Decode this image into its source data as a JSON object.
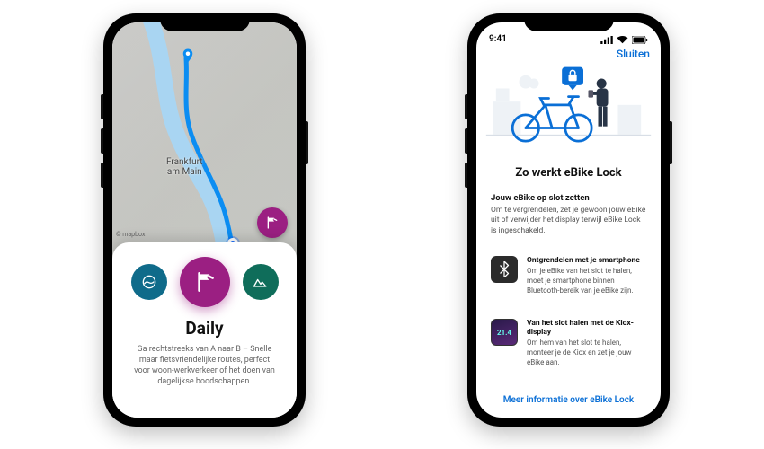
{
  "leftPhone": {
    "map": {
      "cityLabel": "Frankfurt\nam Main",
      "attribution": "© mapbox"
    },
    "fabIcon": "flag",
    "sheet": {
      "modes": {
        "leisure": "leisure",
        "daily": "daily",
        "mountain": "mountain"
      },
      "title": "Daily",
      "desc": "Ga rechtstreeks van A naar B – Snelle maar fietsvriendelijke routes, perfect voor woon-werkverkeer of het doen van dagelijkse boodschappen."
    }
  },
  "rightPhone": {
    "status": {
      "time": "9:41"
    },
    "close": "Sluiten",
    "title": "Zo werkt eBike Lock",
    "intro": {
      "heading": "Jouw eBike op slot zetten",
      "text": "Om te vergrendelen, zet je gewoon jouw eBike uit of verwijder het display terwijl eBike Lock is ingeschakeld."
    },
    "feat1": {
      "heading": "Ontgrendelen met je smartphone",
      "text": "Om je eBike van het slot te halen, moet je smartphone binnen Bluetooth-bereik van je eBike zijn."
    },
    "feat2": {
      "heading": "Van het slot halen met de Kiox-display",
      "text": "Om hem van het slot te halen, monteer je de Kiox en zet je jouw eBike aan.",
      "badge": "21.4"
    },
    "link": "Meer informatie over eBike Lock"
  }
}
